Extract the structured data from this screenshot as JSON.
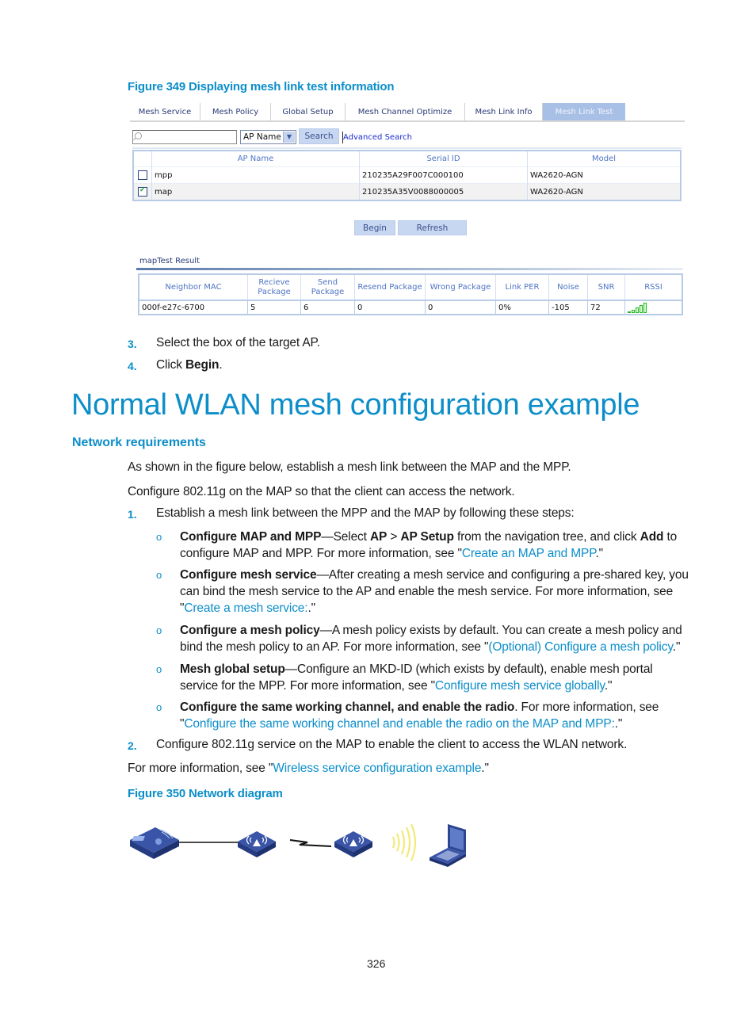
{
  "figure349": {
    "caption": "Figure 349 Displaying mesh link test information",
    "tabs": [
      "Mesh Service",
      "Mesh Policy",
      "Global Setup",
      "Mesh Channel Optimize",
      "Mesh Link Info",
      "Mesh Link Test"
    ],
    "active_tab": "Mesh Link Test",
    "search": {
      "value": "",
      "field_select": "AP Name",
      "search_button": "Search",
      "advanced_link": "Advanced Search"
    },
    "ap_table": {
      "headers": [
        "AP Name",
        "Serial ID",
        "Model"
      ],
      "rows": [
        {
          "checked": false,
          "name": "mpp",
          "serial": "210235A29F007C000100",
          "model": "WA2620-AGN"
        },
        {
          "checked": true,
          "name": "map",
          "serial": "210235A35V0088000005",
          "model": "WA2620-AGN"
        }
      ]
    },
    "buttons": {
      "begin": "Begin",
      "refresh": "Refresh"
    },
    "result": {
      "title": "mapTest Result",
      "headers": [
        "Neighbor MAC",
        "Recieve Package",
        "Send Package",
        "Resend Package",
        "Wrong Package",
        "Link PER",
        "Noise",
        "SNR",
        "RSSI"
      ],
      "headers_line1": [
        "Neighbor MAC",
        "Recieve",
        "Send",
        "Resend Package",
        "Wrong Package",
        "Link PER",
        "Noise",
        "SNR",
        "RSSI"
      ],
      "headers_line2": [
        "",
        "Package",
        "Package",
        "",
        "",
        "",
        "",
        "",
        ""
      ],
      "row": {
        "mac": "000f-e27c-6700",
        "recieve": "5",
        "send": "6",
        "resend": "0",
        "wrong": "0",
        "link_per": "0%",
        "noise": "-105",
        "snr": "72",
        "rssi_bars_lit": 5,
        "rssi_bars_total": 5
      }
    }
  },
  "steps_top": [
    {
      "num": "3.",
      "text": "Select the box of the target AP."
    },
    {
      "num": "4.",
      "pre": "Click ",
      "bold": "Begin",
      "post": "."
    }
  ],
  "section": {
    "title": "Normal WLAN mesh configuration example",
    "subtitle": "Network requirements",
    "intro1": "As shown in the figure below, establish a mesh link between the MAP and the MPP.",
    "intro2": "Configure 802.11g on the MAP so that the client can access the network.",
    "step1": {
      "num": "1.",
      "text": "Establish a mesh link between the MPP and the MAP by following these steps:"
    },
    "bullets": [
      {
        "bold": "Configure MAP and MPP",
        "line1_a": "—Select ",
        "b1": "AP",
        "line1_b": " > ",
        "b2": "AP Setup",
        "line1_c": " from the navigation tree, and click ",
        "b3": "Add",
        "line1_d": " to",
        "line2_a": "configure MAP and MPP. For more information, see \"",
        "link": "Create an MAP and MPP",
        "line2_b": ".\""
      },
      {
        "bold": "Configure mesh service",
        "line1": "—After creating a mesh service and configuring a pre-shared key, you",
        "line2": "can bind the mesh service to the AP and enable the mesh service. For more information, see",
        "line3_a": "\"",
        "link": "Create a mesh service:",
        "line3_b": ".\""
      },
      {
        "bold": "Configure a mesh policy",
        "line1": "—A mesh policy exists by default. You can create a mesh policy and",
        "line2_a": "bind the mesh policy to an AP. For more information, see \"",
        "link": "(Optional) Configure a mesh policy",
        "line2_b": ".\""
      },
      {
        "bold": "Mesh global setup",
        "line1": "—Configure an MKD-ID (which exists by default), enable mesh portal",
        "line2_a": "service for the MPP. For more information, see \"",
        "link": "Configure mesh service globally",
        "line2_b": ".\""
      },
      {
        "bold": "Configure the same working channel, and enable the radio",
        "line1": ". For more information, see",
        "line2_a": "\"",
        "link": "Configure the same working channel and enable the radio on the MAP and MPP:",
        "line2_b": ".\""
      }
    ],
    "step2": {
      "num": "2.",
      "text": "Configure 802.11g service on the MAP to enable the client to access the WLAN network."
    },
    "more_info_a": "For more information, see \"",
    "more_info_link": "Wireless service configuration example",
    "more_info_b": ".\""
  },
  "figure350": {
    "caption": "Figure 350 Network diagram",
    "nodes": [
      "switch-icon",
      "mpp-ap-icon",
      "map-ap-icon",
      "client-laptop-icon"
    ]
  },
  "page_number": "326"
}
